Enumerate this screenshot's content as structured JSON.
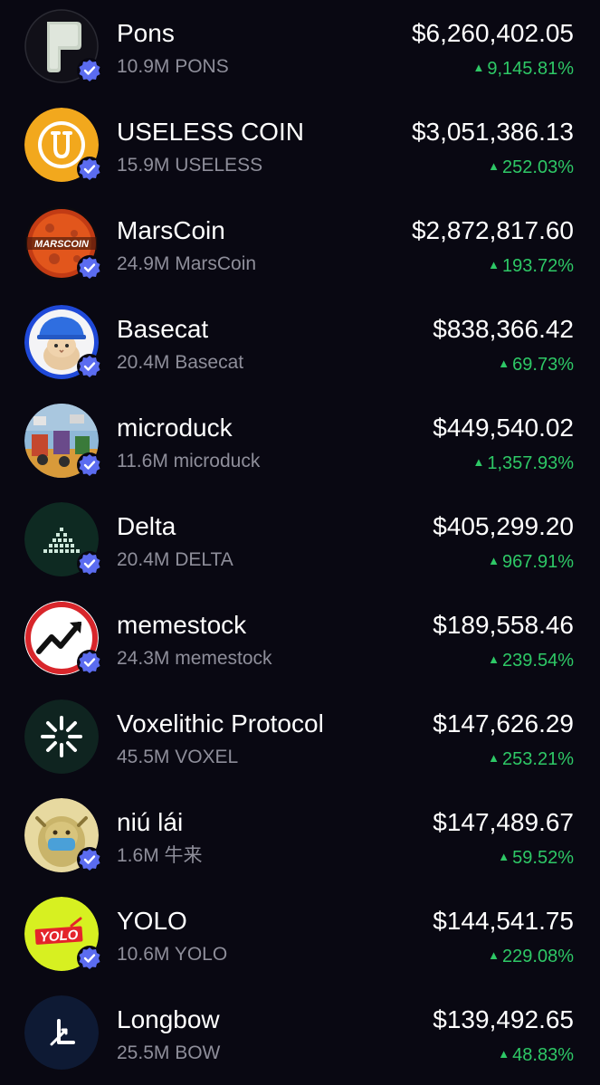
{
  "tokens": [
    {
      "name": "Pons",
      "amount": "10.9M PONS",
      "value": "$6,260,402.05",
      "change": "9,145.81%",
      "icon": "pons-logo"
    },
    {
      "name": "USELESS COIN",
      "amount": "15.9M USELESS",
      "value": "$3,051,386.13",
      "change": "252.03%",
      "icon": "useless-coin-logo"
    },
    {
      "name": "MarsCoin",
      "amount": "24.9M MarsCoin",
      "value": "$2,872,817.60",
      "change": "193.72%",
      "icon": "marscoin-logo",
      "logo_text": "MARSCOIN"
    },
    {
      "name": "Basecat",
      "amount": "20.4M Basecat",
      "value": "$838,366.42",
      "change": "69.73%",
      "icon": "basecat-logo"
    },
    {
      "name": "microduck",
      "amount": "11.6M microduck",
      "value": "$449,540.02",
      "change": "1,357.93%",
      "icon": "microduck-logo"
    },
    {
      "name": "Delta",
      "amount": "20.4M DELTA",
      "value": "$405,299.20",
      "change": "967.91%",
      "icon": "delta-logo"
    },
    {
      "name": "memestock",
      "amount": "24.3M memestock",
      "value": "$189,558.46",
      "change": "239.54%",
      "icon": "memestock-logo"
    },
    {
      "name": "Voxelithic Protocol",
      "amount": "45.5M VOXEL",
      "value": "$147,626.29",
      "change": "253.21%",
      "icon": "voxel-logo"
    },
    {
      "name": "niú lái",
      "amount": "1.6M 牛来",
      "value": "$147,489.67",
      "change": "59.52%",
      "icon": "niulai-logo"
    },
    {
      "name": "YOLO",
      "amount": "10.6M YOLO",
      "value": "$144,541.75",
      "change": "229.08%",
      "icon": "yolo-logo",
      "logo_text": "YOLO"
    },
    {
      "name": "Longbow",
      "amount": "25.5M BOW",
      "value": "$139,492.65",
      "change": "48.83%",
      "icon": "longbow-logo"
    }
  ],
  "colors": {
    "background": "#090812",
    "positive": "#2ec866",
    "verified": "#5b6cf0",
    "muted": "#8e8e9a"
  },
  "verified_icon": "verified-badge-icon",
  "change_icon": "up-triangle-icon"
}
